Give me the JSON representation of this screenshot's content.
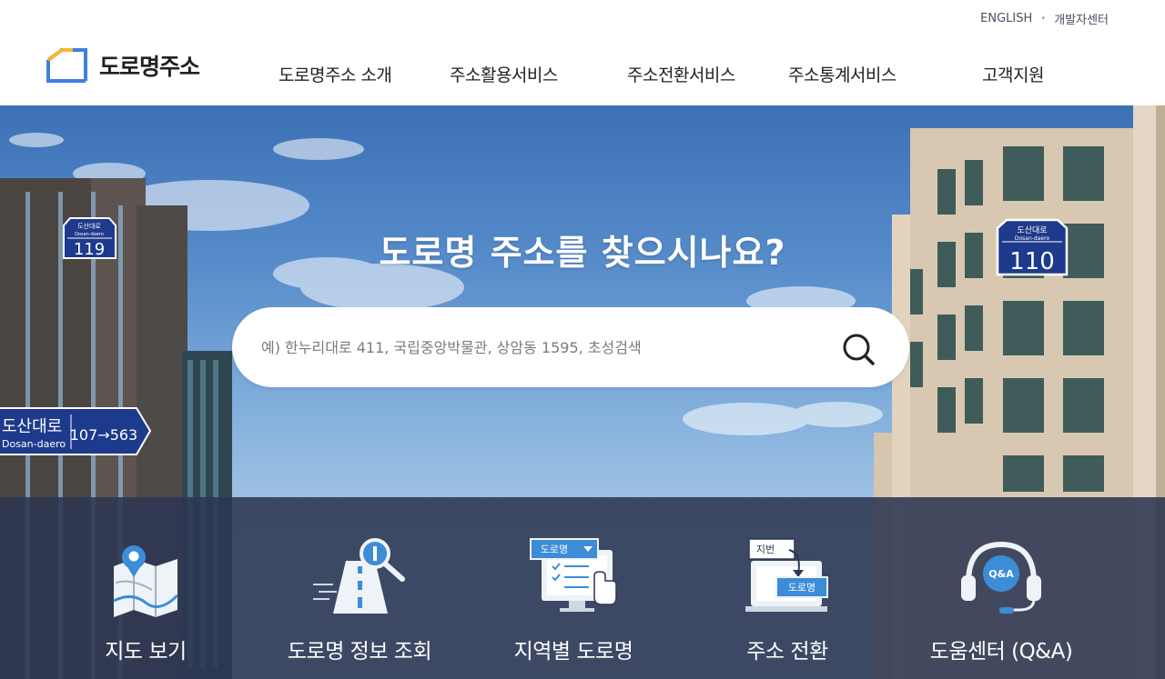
{
  "header": {
    "util_links": [
      "ENGLISH",
      "개발자센터"
    ],
    "logo_text": "도로명주소",
    "nav": [
      "도로명주소 소개",
      "주소활용서비스",
      "주소전환서비스",
      "주소통계서비스",
      "고객지원"
    ]
  },
  "hero": {
    "title": "도로명 주소를 찾으시나요?",
    "search_placeholder": "예) 한누리대로 411, 국립중앙박물관, 상암동 1595, 초성검색",
    "signs": {
      "left_small": {
        "top": "도산대로",
        "mid": "Dosan-daero",
        "num": "119"
      },
      "left_big": {
        "name": "도산대로",
        "roman": "Dosan-daero",
        "range": "107→563"
      },
      "right": {
        "top": "도산대로",
        "mid": "Dosan-daero",
        "num": "110"
      }
    }
  },
  "quick_menu": [
    {
      "label": "지도 보기",
      "icon": "map-pin-icon"
    },
    {
      "label": "도로명 정보 조회",
      "icon": "road-search-icon"
    },
    {
      "label": "지역별 도로명",
      "icon": "regional-road-icon",
      "badge": "도로명"
    },
    {
      "label": "주소 전환",
      "icon": "address-convert-icon",
      "badge_top": "지번",
      "badge_bottom": "도로명"
    },
    {
      "label": "도움센터 (Q&A)",
      "icon": "headset-qa-icon",
      "badge": "Q&A"
    }
  ],
  "colors": {
    "brand_blue": "#3f7fe0",
    "brand_yellow": "#f4b82c",
    "quick_bg": "#2c3752",
    "sign_blue": "#1e3a8c"
  }
}
